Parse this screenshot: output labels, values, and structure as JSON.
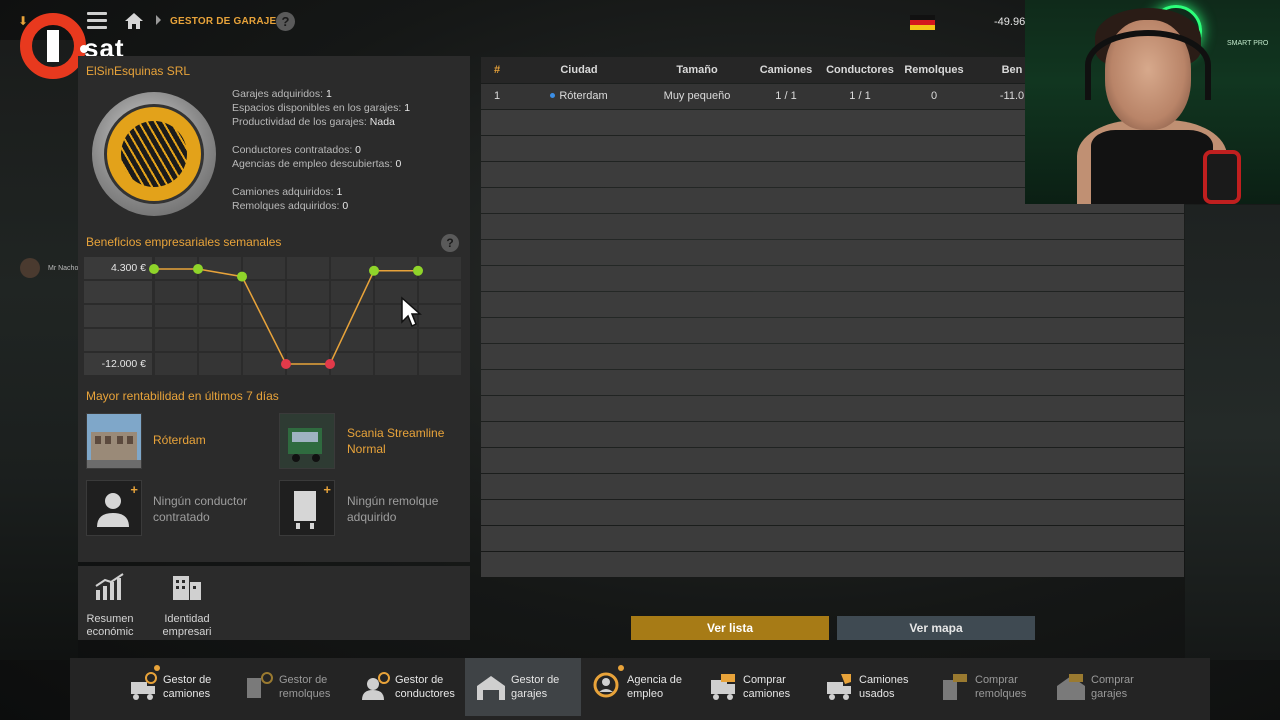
{
  "topbar": {
    "title": "GESTOR DE GARAJES",
    "help": "?",
    "money": "-49.96"
  },
  "overlay": {
    "logo_text": "sat",
    "viewer_name": "Mr Nachota",
    "webcam_text": "SMART PRO"
  },
  "company": {
    "name": "ElSinEsquinas SRL",
    "stats": [
      {
        "label": "Garajes adquiridos:",
        "value": "1"
      },
      {
        "label": "Espacios disponibles en los garajes:",
        "value": "1"
      },
      {
        "label": "Productividad de los garajes:",
        "value": "Nada"
      },
      {
        "label": "Conductores contratados:",
        "value": "0"
      },
      {
        "label": "Agencias de empleo descubiertas:",
        "value": "0"
      },
      {
        "label": "Camiones adquiridos:",
        "value": "1"
      },
      {
        "label": "Remolques adquiridos:",
        "value": "0"
      }
    ]
  },
  "chart_data": {
    "type": "line",
    "title": "Beneficios empresariales semanales",
    "y_labels": [
      "4.300 €",
      "-12.000 €"
    ],
    "ylim": [
      -12000,
      4300
    ],
    "values": [
      4300,
      4300,
      3000,
      -12000,
      -12000,
      4000,
      4000
    ],
    "colors": {
      "line": "#e8a33a",
      "positive": "#8fd42a",
      "negative": "#e23a4a"
    }
  },
  "rentability": {
    "title": "Mayor rentabilidad en últimos 7 días",
    "city": "Róterdam",
    "truck": "Scania Streamline Normal",
    "no_driver": "Ningún conductor contratado",
    "no_trailer": "Ningún remolque adquirido"
  },
  "left_icons": [
    {
      "label": "Resumen económic"
    },
    {
      "label": "Identidad empresari"
    }
  ],
  "table": {
    "headers": [
      "#",
      "Ciudad",
      "Tamaño",
      "Camiones",
      "Conductores",
      "Remolques",
      "Ben"
    ],
    "rows": [
      {
        "num": "1",
        "city": "Róterdam",
        "size": "Muy pequeño",
        "trucks": "1 / 1",
        "drivers": "1 / 1",
        "trailers": "0",
        "profit": "-11.0"
      }
    ]
  },
  "buttons": {
    "list": "Ver lista",
    "map": "Ver mapa"
  },
  "nav": [
    {
      "label1": "Gestor de",
      "label2": "camiones",
      "icon": "truck-gear-icon",
      "dot": true,
      "dim": false
    },
    {
      "label1": "Gestor de",
      "label2": "remolques",
      "icon": "trailer-gear-icon",
      "dot": false,
      "dim": true
    },
    {
      "label1": "Gestor de",
      "label2": "conductores",
      "icon": "driver-gear-icon",
      "dot": false,
      "dim": false
    },
    {
      "label1": "Gestor de",
      "label2": "garajes",
      "icon": "garage-icon",
      "dot": false,
      "dim": false,
      "active": true
    },
    {
      "label1": "Agencia de",
      "label2": "empleo",
      "icon": "agency-icon",
      "dot": true,
      "dim": false
    },
    {
      "label1": "Comprar",
      "label2": "camiones",
      "icon": "buy-truck-icon",
      "dot": false,
      "dim": false
    },
    {
      "label1": "Camiones",
      "label2": "usados",
      "icon": "used-truck-icon",
      "dot": false,
      "dim": false
    },
    {
      "label1": "Comprar",
      "label2": "remolques",
      "icon": "buy-trailer-icon",
      "dot": false,
      "dim": true
    },
    {
      "label1": "Comprar",
      "label2": "garajes",
      "icon": "buy-garage-icon",
      "dot": false,
      "dim": true
    }
  ]
}
